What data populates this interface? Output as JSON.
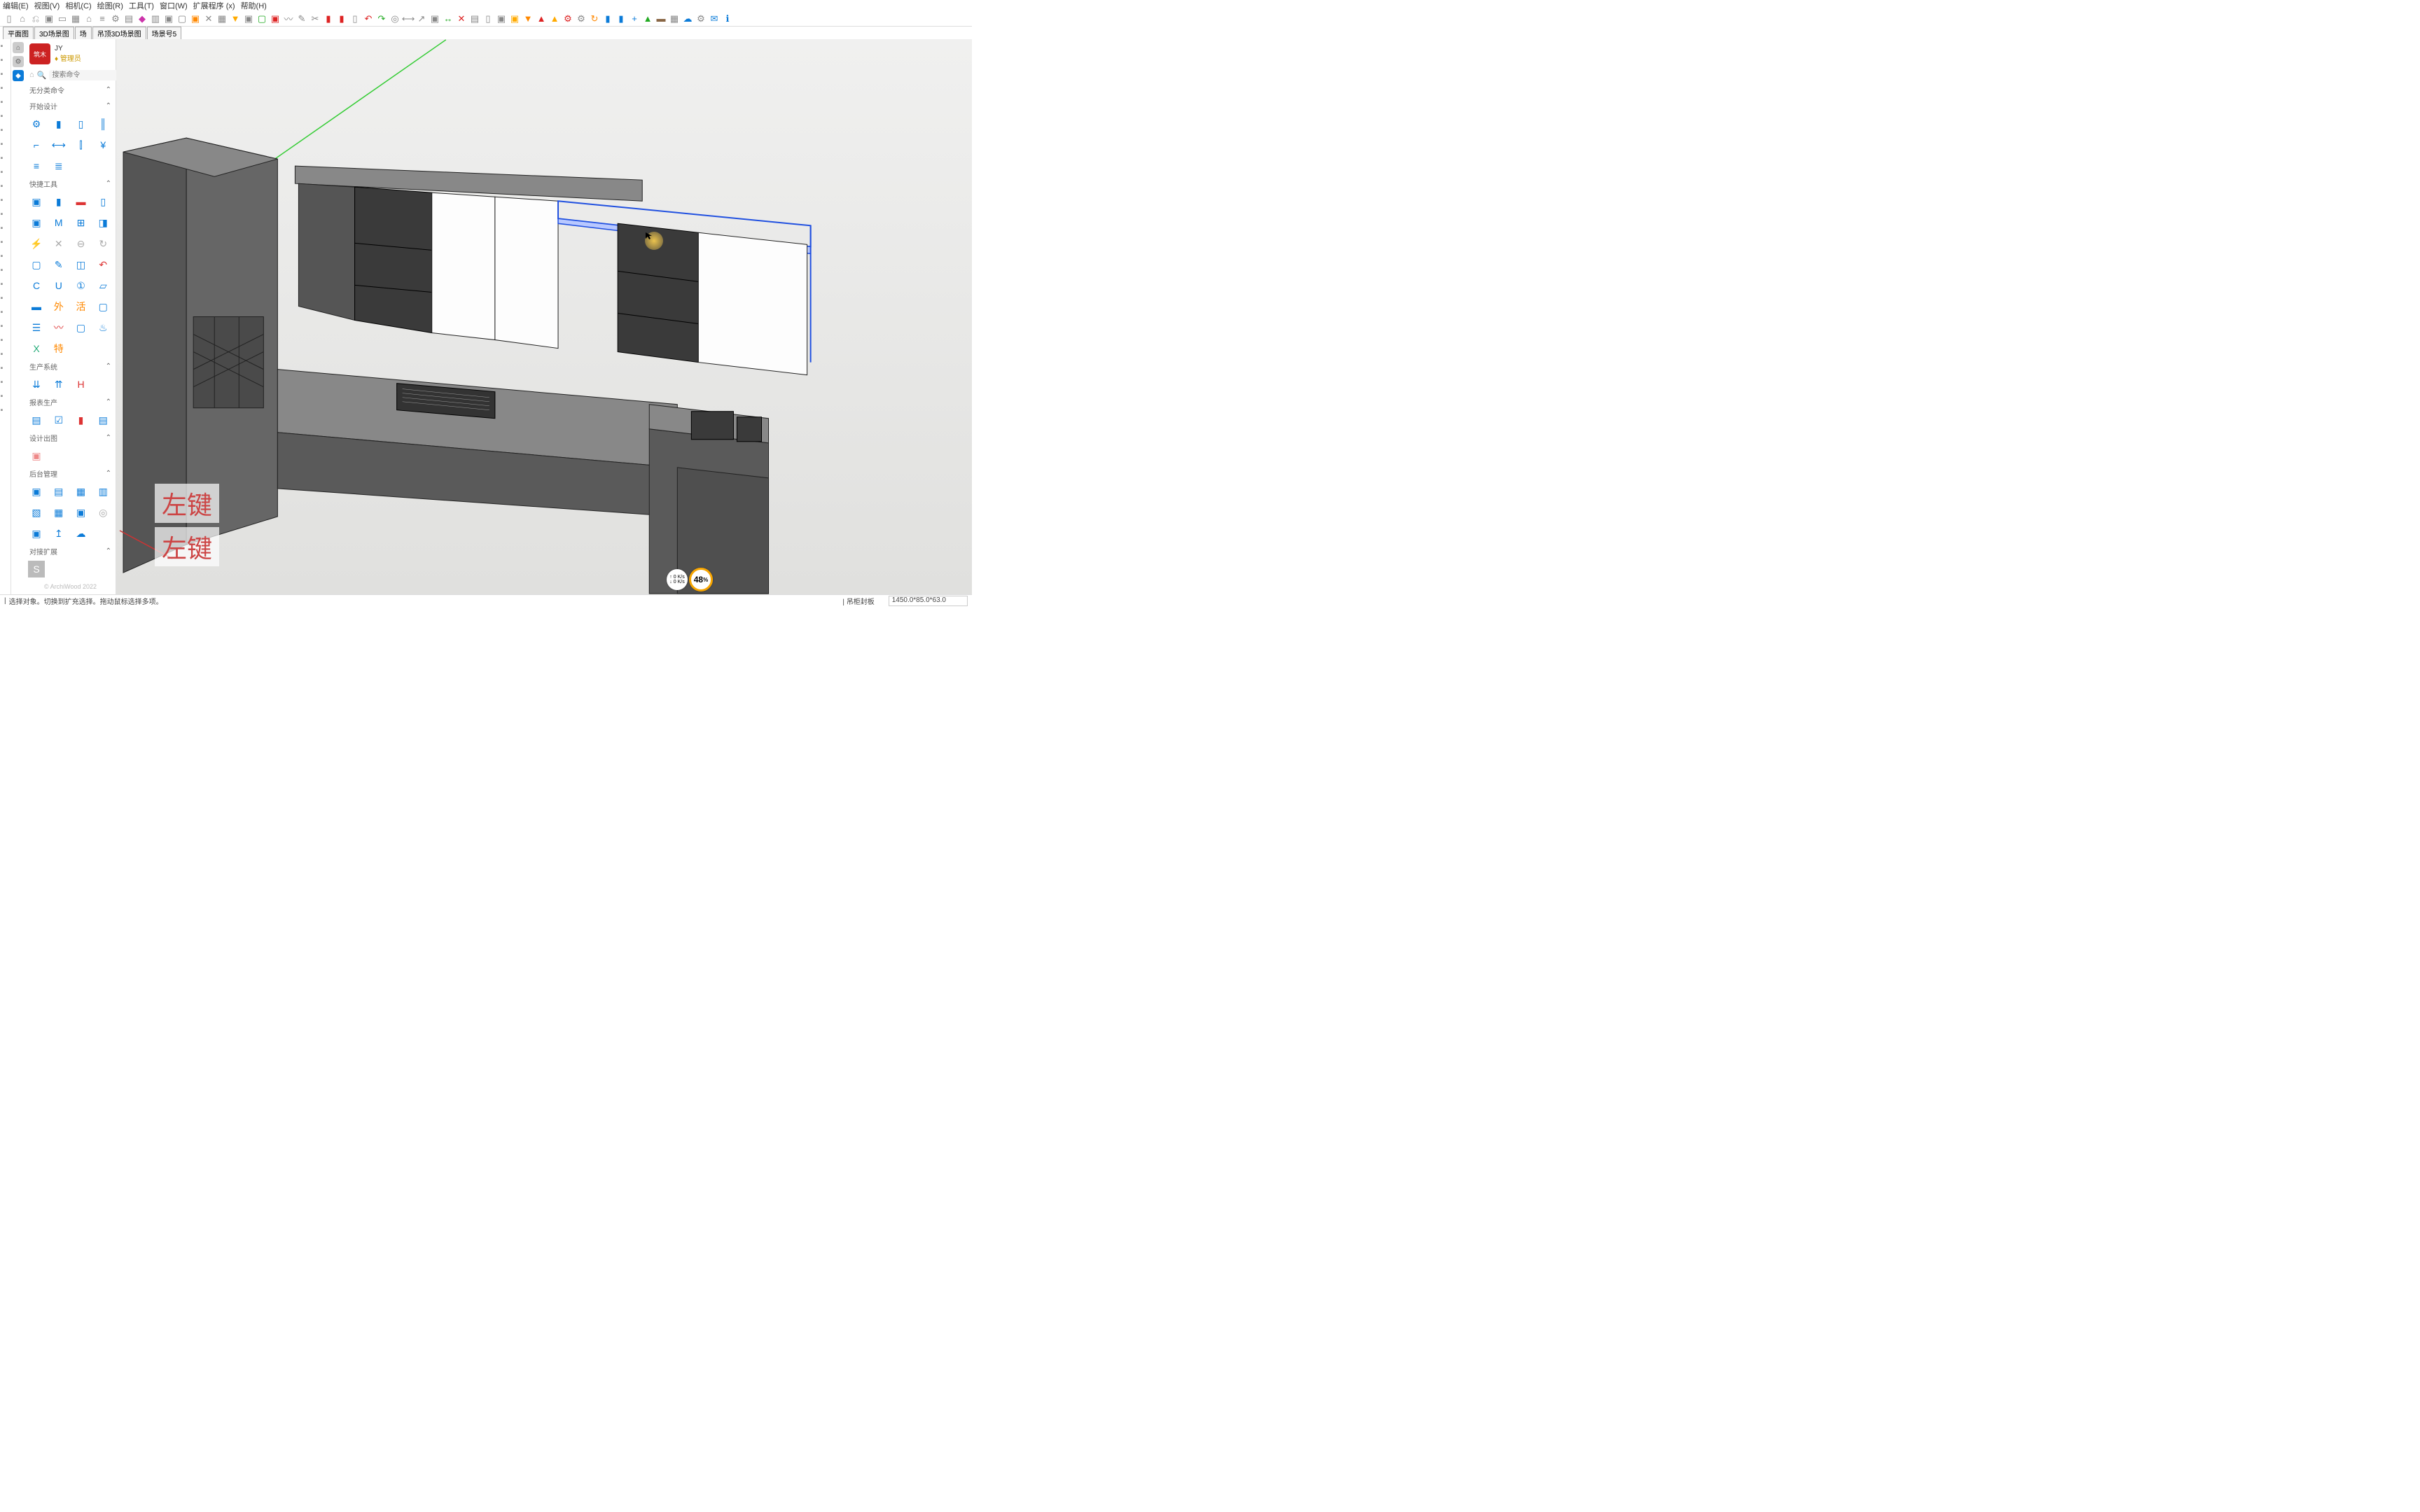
{
  "menu": [
    "编辑(E)",
    "视图(V)",
    "相机(C)",
    "绘图(R)",
    "工具(T)",
    "窗口(W)",
    "扩展程序 (x)",
    "帮助(H)"
  ],
  "toolbar_icons": [
    "new",
    "open",
    "break",
    "cube",
    "row",
    "box",
    "house",
    "stairs",
    "gear",
    "layers",
    "gem",
    "panel3",
    "cube2",
    "cubeo",
    "orange-cube",
    "cross-tools",
    "grid",
    "down",
    "cube3",
    "green-box",
    "redbox",
    "curve",
    "pencil",
    "scissors",
    "red1",
    "red2",
    "cut",
    "undo",
    "redo",
    "target",
    "dim",
    "arrow",
    "camera",
    "move-g",
    "redcross",
    "paint",
    "rect",
    "film",
    "yellow-cube",
    "orange-dn",
    "up-red",
    "yellow-up",
    "red-cfg",
    "gear2",
    "refresh",
    "flag1",
    "flag2",
    "plus",
    "tree",
    "brown",
    "checker",
    "cloud",
    "cfg",
    "mail",
    "info"
  ],
  "tabs": [
    "平面图",
    "3D场景图",
    "场",
    "吊顶3D场景图",
    "场景号5"
  ],
  "side_icons": [
    {
      "name": "home",
      "active": false
    },
    {
      "name": "gear",
      "active": false
    },
    {
      "name": "cube",
      "active": true
    }
  ],
  "user": {
    "name": "JY",
    "role": "管理员",
    "avatar_caption": "筑木"
  },
  "search_placeholder": "搜索命令",
  "sections": [
    {
      "title": "无分类命令",
      "tools": []
    },
    {
      "title": "开始设计",
      "tools": [
        "gear",
        "rect1",
        "rect2",
        "cols",
        "corner",
        "dim",
        "adjust",
        "yen",
        "eq1",
        "eq2"
      ]
    },
    {
      "title": "快捷工具",
      "tools": [
        "cube-b",
        "col-b",
        "red-sq",
        "sq-gap",
        "sq-b",
        "M",
        "grid4",
        "half",
        "bolt",
        "bolt2",
        "link",
        "cycle",
        "sq1",
        "eyedrop",
        "split",
        "undo",
        "C",
        "U",
        "one",
        "plane",
        "folder",
        "ext",
        "live",
        "sq2",
        "bars",
        "wave",
        "sq3",
        "fire",
        "xls",
        "spec"
      ]
    },
    {
      "title": "生产系统",
      "tools": [
        "down-ar",
        "up-ar",
        "H-red"
      ]
    },
    {
      "title": "报表生产",
      "tools": [
        "page",
        "check",
        "red-sig",
        "list"
      ]
    },
    {
      "title": "设计出图",
      "tools": [
        "pink-sq"
      ]
    },
    {
      "title": "后台管理",
      "tools": [
        "db1",
        "layout",
        "db2",
        "db3",
        "layout2",
        "db4",
        "gift",
        "target",
        "db5",
        "upload",
        "cloud"
      ]
    },
    {
      "title": "对接扩展",
      "tools": [
        "s-box"
      ]
    }
  ],
  "footer": "© ArchiWood 2022",
  "click_hints": [
    "左键",
    "左键"
  ],
  "speed": {
    "up": "0 K/s",
    "down": "0 K/s",
    "pct": "48"
  },
  "status": {
    "left": "选择对象。切换到扩充选择。拖动鼠标选择多项。",
    "label": "吊柜封板",
    "dims": "1450.0*85.0*63.0"
  },
  "colors": {
    "accent": "#0b7bd8",
    "orange": "#f7a500",
    "red": "#d33"
  }
}
